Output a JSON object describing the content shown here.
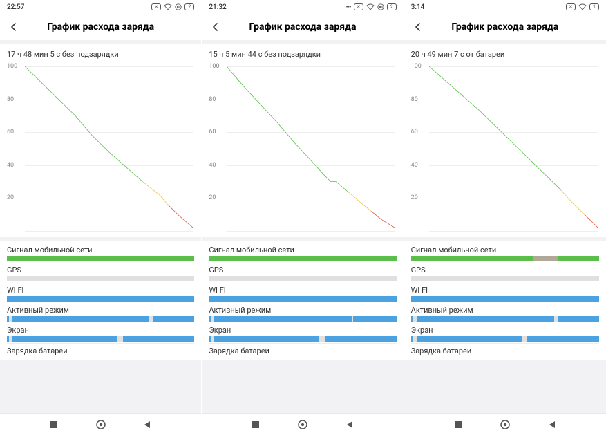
{
  "colors": {
    "green": "#5bbd4a",
    "yellow": "#e8c547",
    "red": "#e05a4a",
    "blue": "#4aa3e0",
    "gray": "#b0a99a",
    "track": "#e0e0e0"
  },
  "axis_ticks": [
    "100",
    "80",
    "60",
    "40",
    "20"
  ],
  "bar_labels": {
    "signal": "Сигнал мобильной сети",
    "gps": "GPS",
    "wifi": "Wi-Fi",
    "active": "Активный режим",
    "screen": "Экран",
    "charging": "Зарядка батареи"
  },
  "screens": [
    {
      "time": "22:57",
      "battery_text": "2",
      "show_vpn": true,
      "show_dots": false,
      "title": "График расхода заряда",
      "caption": "17 ч 48 мин 5 с без подзарядки",
      "bars": {
        "signal": [
          {
            "s": 0,
            "e": 100,
            "c": "green"
          }
        ],
        "gps": [],
        "wifi": [
          {
            "s": 0,
            "e": 100,
            "c": "blue"
          }
        ],
        "active": [
          {
            "s": 0,
            "e": 1,
            "c": "blue"
          },
          {
            "s": 3,
            "e": 76,
            "c": "blue"
          },
          {
            "s": 78,
            "e": 100,
            "c": "blue"
          }
        ],
        "screen": [
          {
            "s": 0,
            "e": 1,
            "c": "blue"
          },
          {
            "s": 3,
            "e": 59,
            "c": "blue"
          },
          {
            "s": 62,
            "e": 100,
            "c": "blue"
          }
        ]
      }
    },
    {
      "time": "21:32",
      "battery_text": "2",
      "show_vpn": true,
      "show_dots": true,
      "title": "График расхода заряда",
      "caption": "15 ч 5 мин 44 с без подзарядки",
      "bars": {
        "signal": [
          {
            "s": 0,
            "e": 100,
            "c": "green"
          }
        ],
        "gps": [],
        "wifi": [
          {
            "s": 0,
            "e": 100,
            "c": "blue"
          }
        ],
        "active": [
          {
            "s": 0,
            "e": 1,
            "c": "blue"
          },
          {
            "s": 3,
            "e": 76,
            "c": "blue"
          },
          {
            "s": 77,
            "e": 100,
            "c": "blue"
          }
        ],
        "screen": [
          {
            "s": 0,
            "e": 1,
            "c": "blue"
          },
          {
            "s": 3,
            "e": 59,
            "c": "blue"
          },
          {
            "s": 62,
            "e": 100,
            "c": "blue"
          }
        ]
      }
    },
    {
      "time": "3:14",
      "battery_text": "1",
      "show_vpn": false,
      "show_dots": false,
      "title": "График расхода заряда",
      "caption": "20 ч 49 мин 7 с от батареи",
      "bars": {
        "signal": [
          {
            "s": 0,
            "e": 65,
            "c": "green"
          },
          {
            "s": 65,
            "e": 78,
            "c": "gray"
          },
          {
            "s": 78,
            "e": 100,
            "c": "green"
          }
        ],
        "gps": [],
        "wifi": [
          {
            "s": 0,
            "e": 100,
            "c": "blue"
          }
        ],
        "active": [
          {
            "s": 0,
            "e": 1,
            "c": "blue"
          },
          {
            "s": 3,
            "e": 76,
            "c": "blue"
          },
          {
            "s": 78,
            "e": 100,
            "c": "blue"
          }
        ],
        "screen": [
          {
            "s": 0,
            "e": 1,
            "c": "blue"
          },
          {
            "s": 3,
            "e": 59,
            "c": "blue"
          },
          {
            "s": 62,
            "e": 100,
            "c": "blue"
          }
        ]
      }
    }
  ],
  "chart_data": [
    {
      "type": "line",
      "title": "График расхода заряда",
      "ylabel": "%",
      "ylim": [
        0,
        100
      ],
      "x": [
        0,
        10,
        20,
        30,
        40,
        48,
        50,
        60,
        70,
        80,
        85,
        92,
        100
      ],
      "y": [
        100,
        90,
        80,
        70,
        58,
        50,
        48,
        39,
        30,
        22,
        16,
        9,
        2
      ],
      "series_color_breaks": [
        {
          "until_y": 35,
          "color": "green"
        },
        {
          "until_y": 18,
          "color": "yellow"
        },
        {
          "until_y": 0,
          "color": "red"
        }
      ]
    },
    {
      "type": "line",
      "title": "График расхода заряда",
      "ylabel": "%",
      "ylim": [
        0,
        100
      ],
      "x": [
        0,
        10,
        20,
        30,
        40,
        50,
        58,
        62,
        65,
        72,
        80,
        86,
        92,
        100
      ],
      "y": [
        100,
        88,
        77,
        66,
        54,
        43,
        34,
        30,
        30,
        24,
        17,
        12,
        7,
        2
      ],
      "series_color_breaks": [
        {
          "until_y": 30,
          "color": "green"
        },
        {
          "until_y": 15,
          "color": "yellow"
        },
        {
          "until_y": 0,
          "color": "red"
        }
      ]
    },
    {
      "type": "line",
      "title": "График расхода заряда",
      "ylabel": "%",
      "ylim": [
        0,
        100
      ],
      "x": [
        0,
        10,
        20,
        30,
        40,
        50,
        60,
        70,
        78,
        85,
        92,
        100
      ],
      "y": [
        100,
        91,
        82,
        73,
        63,
        53,
        43,
        33,
        25,
        17,
        10,
        2
      ],
      "series_color_breaks": [
        {
          "until_y": 30,
          "color": "green"
        },
        {
          "until_y": 15,
          "color": "yellow"
        },
        {
          "until_y": 0,
          "color": "red"
        }
      ]
    }
  ]
}
